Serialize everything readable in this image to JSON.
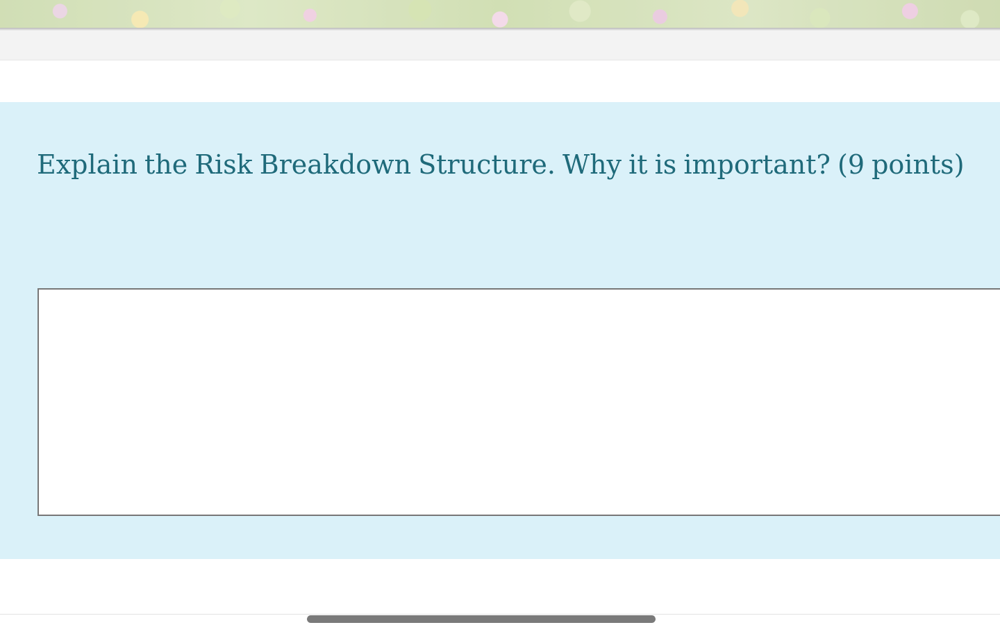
{
  "question": {
    "text": "Explain the Risk Breakdown Structure. Why it is important? (9 points)"
  },
  "answer": {
    "value": "",
    "placeholder": ""
  },
  "colors": {
    "question_background": "#daf1f9",
    "question_text": "#1f6a7a",
    "answer_border": "#777777",
    "scrollbar_thumb": "#7a7a7a"
  },
  "icons": {
    "banner": "floral-banner-image"
  }
}
